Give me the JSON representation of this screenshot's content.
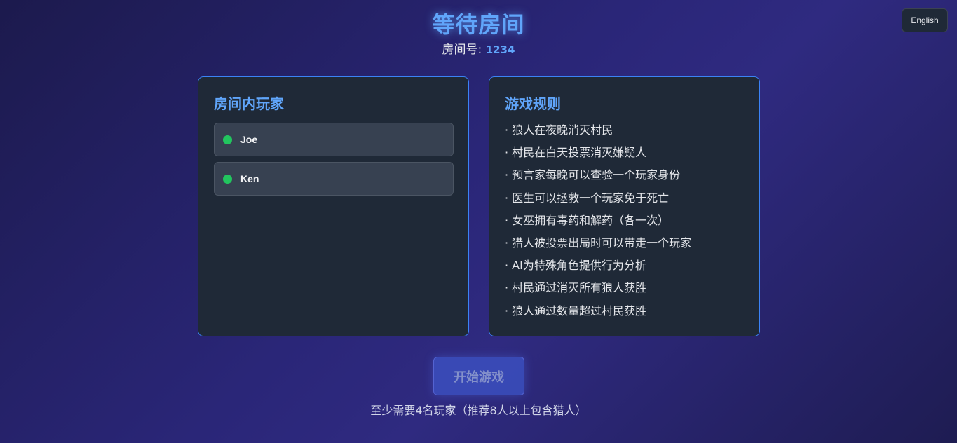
{
  "header": {
    "language_button": "English",
    "title": "等待房间",
    "room_label": "房间号: ",
    "room_number": "1234"
  },
  "players_panel": {
    "title": "房间内玩家",
    "players": [
      {
        "name": "Joe",
        "status_color": "#22c55e"
      },
      {
        "name": "Ken",
        "status_color": "#22c55e"
      }
    ]
  },
  "rules_panel": {
    "title": "游戏规则",
    "rules": [
      "· 狼人在夜晚消灭村民",
      "· 村民在白天投票消灭嫌疑人",
      "· 预言家每晚可以查验一个玩家身份",
      "· 医生可以拯救一个玩家免于死亡",
      "· 女巫拥有毒药和解药（各一次）",
      "· 猎人被投票出局时可以带走一个玩家",
      "· AI为特殊角色提供行为分析",
      "· 村民通过消灭所有狼人获胜",
      "· 狼人通过数量超过村民获胜"
    ]
  },
  "footer": {
    "start_button": "开始游戏",
    "hint": "至少需要4名玩家（推荐8人以上包含猎人）"
  },
  "colors": {
    "accent": "#60a5fa",
    "online": "#22c55e",
    "panel_bg": "#1f2937",
    "panel_border": "#3b82f6"
  }
}
